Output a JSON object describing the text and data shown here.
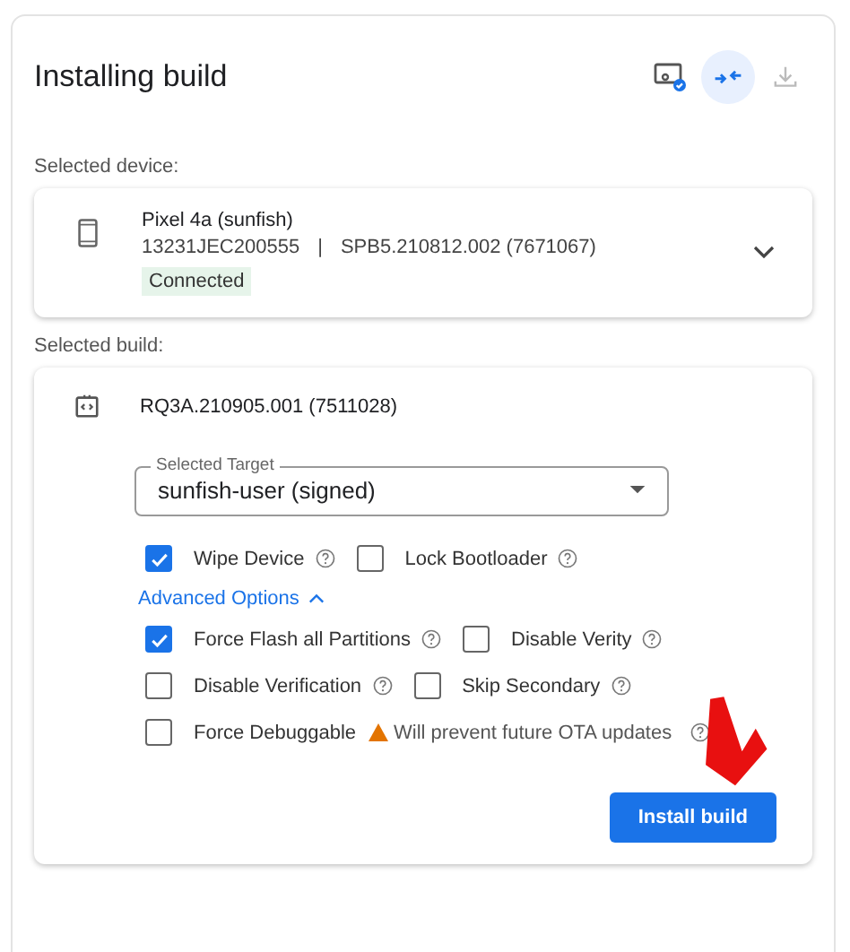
{
  "title": "Installing build",
  "header_icons": [
    {
      "kind": "device",
      "selected": false
    },
    {
      "kind": "collapse",
      "selected": true
    },
    {
      "kind": "download",
      "selected": false
    }
  ],
  "device_section": {
    "label": "Selected device:",
    "name": "Pixel 4a (sunfish)",
    "serial": "13231JEC200555",
    "separator": "|",
    "build": "SPB5.210812.002 (7671067)",
    "status": "Connected",
    "expanded": false
  },
  "build_section": {
    "label": "Selected build:",
    "build": "RQ3A.210905.001 (7511028)",
    "target": {
      "label": "Selected Target",
      "value": "sunfish-user (signed)"
    },
    "options": [
      [
        {
          "label": "Wipe Device",
          "checked": true
        },
        {
          "label": "Lock Bootloader",
          "checked": false
        }
      ]
    ],
    "advanced": {
      "label": "Advanced Options",
      "expanded": true
    },
    "advanced_options": [
      [
        {
          "label": "Force Flash all Partitions",
          "checked": true
        },
        {
          "label": "Disable Verity",
          "checked": false
        }
      ],
      [
        {
          "label": "Disable Verification",
          "checked": false
        },
        {
          "label": "Skip Secondary",
          "checked": false
        }
      ],
      [
        {
          "label": "Force Debuggable",
          "checked": false,
          "warning": "Will prevent future OTA updates"
        }
      ]
    ],
    "install_button": "Install build"
  }
}
